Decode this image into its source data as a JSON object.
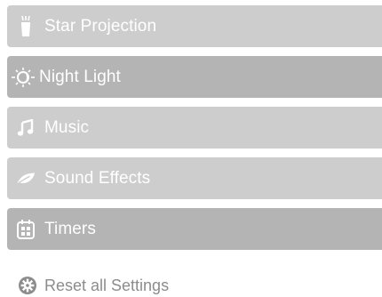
{
  "menu": {
    "items": [
      {
        "label": "Star Projection",
        "icon": "star-projector-icon",
        "shade": "light"
      },
      {
        "label": "Night Light",
        "icon": "sun-moon-icon",
        "shade": "dark"
      },
      {
        "label": "Music",
        "icon": "music-note-icon",
        "shade": "light"
      },
      {
        "label": "Sound Effects",
        "icon": "leaf-icon",
        "shade": "light"
      },
      {
        "label": "Timers",
        "icon": "calendar-icon",
        "shade": "dark"
      }
    ]
  },
  "reset": {
    "label": "Reset all Settings",
    "icon": "gear-icon"
  },
  "colors": {
    "item_light": "#cdcdcd",
    "item_dark": "#b4b4b4",
    "item_text": "#ffffff",
    "reset_text": "#8c8c8c"
  }
}
